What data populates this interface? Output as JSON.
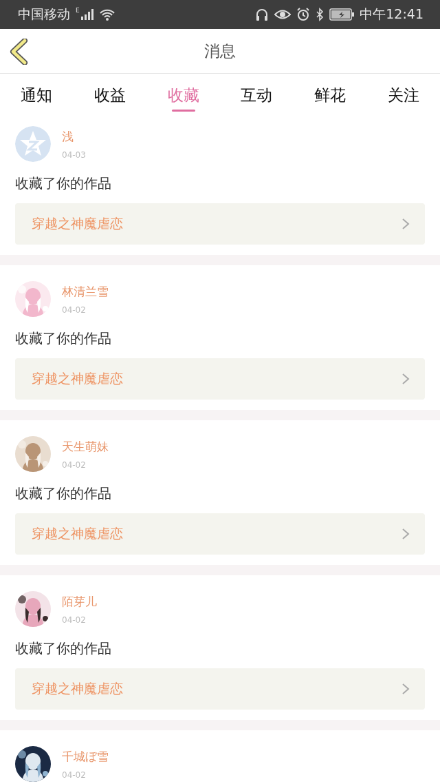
{
  "status_bar": {
    "carrier": "中国移动",
    "network": "E",
    "time": "中午12:41"
  },
  "header": {
    "title": "消息"
  },
  "tabs": [
    {
      "label": "通知",
      "selected": false
    },
    {
      "label": "收益",
      "selected": false
    },
    {
      "label": "收藏",
      "selected": true
    },
    {
      "label": "互动",
      "selected": false
    },
    {
      "label": "鲜花",
      "selected": false
    },
    {
      "label": "关注",
      "selected": false
    }
  ],
  "messages": [
    {
      "avatar": {
        "kind": "default"
      },
      "name": "浅",
      "date": "04-03",
      "action": "收藏了你的作品",
      "book": "穿越之神魔虐恋"
    },
    {
      "name": "林清兰雪",
      "date": "04-02",
      "action": "收藏了你的作品",
      "book": "穿越之神魔虐恋"
    },
    {
      "name": "天生萌妹",
      "date": "04-02",
      "action": "收藏了你的作品",
      "book": "穿越之神魔虐恋"
    },
    {
      "name": "陌芽儿",
      "date": "04-02",
      "action": "收藏了你的作品",
      "book": "穿越之神魔虐恋"
    },
    {
      "name": "千城ぼ雪",
      "date": "04-02"
    }
  ]
}
